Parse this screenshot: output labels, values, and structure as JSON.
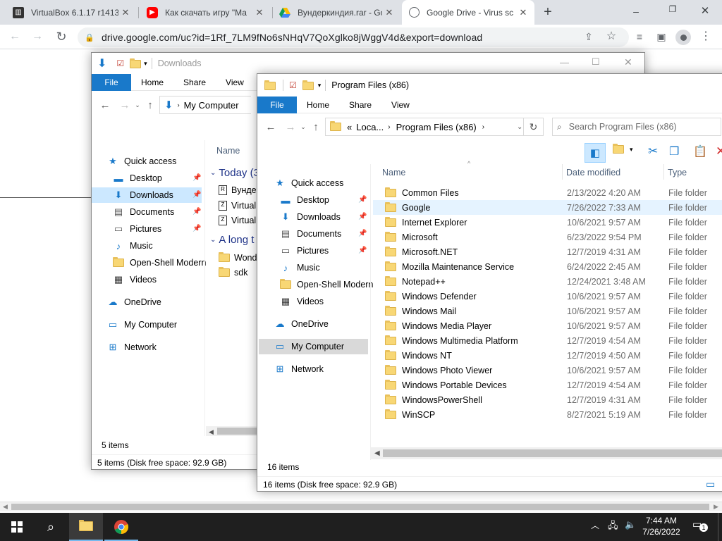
{
  "browser": {
    "tabs": [
      {
        "title": "VirtualBox 6.1.17 r1413",
        "icon": "virtualbox-icon"
      },
      {
        "title": "Как скачать игру \"Ма",
        "icon": "youtube-icon"
      },
      {
        "title": "Вундеркиндия.rar - Go",
        "icon": "google-drive-icon"
      },
      {
        "title": "Google Drive - Virus sc",
        "icon": "globe-icon"
      }
    ],
    "url": "drive.google.com/uc?id=1Rf_7LM9fNo6sNHqV7QoXglko8jWggV4d&export=download"
  },
  "downloads_window": {
    "title": "Downloads",
    "ribbon": [
      "File",
      "Home",
      "Share",
      "View"
    ],
    "address": "My Computer",
    "nav": [
      {
        "label": "Quick access",
        "icon": "star-icon"
      },
      {
        "label": "Desktop",
        "icon": "desktop-icon",
        "pinned": true
      },
      {
        "label": "Downloads",
        "icon": "download-arrow-icon",
        "pinned": true
      },
      {
        "label": "Documents",
        "icon": "documents-icon",
        "pinned": true
      },
      {
        "label": "Pictures",
        "icon": "pictures-icon",
        "pinned": true
      },
      {
        "label": "Music",
        "icon": "music-icon"
      },
      {
        "label": "Open-Shell Modern",
        "icon": "folder-icon"
      },
      {
        "label": "Videos",
        "icon": "videos-icon"
      },
      {
        "label": "OneDrive",
        "icon": "onedrive-icon"
      },
      {
        "label": "My Computer",
        "icon": "computer-icon"
      },
      {
        "label": "Network",
        "icon": "network-icon"
      }
    ],
    "column_name": "Name",
    "groups": [
      {
        "label": "Today (3",
        "items": [
          "Вундер",
          "Virtuall",
          "Virtual"
        ]
      },
      {
        "label": "A long t",
        "items": [
          "Wonde",
          "sdk"
        ]
      }
    ],
    "item_count": "5 items",
    "status": "5 items (Disk free space: 92.9 GB)"
  },
  "program_files_window": {
    "title": "Program Files (x86)",
    "ribbon": [
      "File",
      "Home",
      "Share",
      "View"
    ],
    "breadcrumb": [
      "«",
      "Loca...",
      "Program Files (x86)"
    ],
    "search_placeholder": "Search Program Files (x86)",
    "nav": [
      {
        "label": "Quick access",
        "icon": "star-icon"
      },
      {
        "label": "Desktop",
        "icon": "desktop-icon",
        "pinned": true
      },
      {
        "label": "Downloads",
        "icon": "download-arrow-icon",
        "pinned": true
      },
      {
        "label": "Documents",
        "icon": "documents-icon",
        "pinned": true
      },
      {
        "label": "Pictures",
        "icon": "pictures-icon",
        "pinned": true
      },
      {
        "label": "Music",
        "icon": "music-icon"
      },
      {
        "label": "Open-Shell Modern",
        "icon": "folder-icon"
      },
      {
        "label": "Videos",
        "icon": "videos-icon"
      },
      {
        "label": "OneDrive",
        "icon": "onedrive-icon"
      },
      {
        "label": "My Computer",
        "icon": "computer-icon"
      },
      {
        "label": "Network",
        "icon": "network-icon"
      }
    ],
    "columns": {
      "name": "Name",
      "date": "Date modified",
      "type": "Type"
    },
    "files": [
      {
        "name": "Common Files",
        "date": "2/13/2022 4:20 AM",
        "type": "File folder"
      },
      {
        "name": "Google",
        "date": "7/26/2022 7:33 AM",
        "type": "File folder"
      },
      {
        "name": "Internet Explorer",
        "date": "10/6/2021 9:57 AM",
        "type": "File folder"
      },
      {
        "name": "Microsoft",
        "date": "6/23/2022 9:54 PM",
        "type": "File folder"
      },
      {
        "name": "Microsoft.NET",
        "date": "12/7/2019 4:31 AM",
        "type": "File folder"
      },
      {
        "name": "Mozilla Maintenance Service",
        "date": "6/24/2022 2:45 AM",
        "type": "File folder"
      },
      {
        "name": "Notepad++",
        "date": "12/24/2021 3:48 AM",
        "type": "File folder"
      },
      {
        "name": "Windows Defender",
        "date": "10/6/2021 9:57 AM",
        "type": "File folder"
      },
      {
        "name": "Windows Mail",
        "date": "10/6/2021 9:57 AM",
        "type": "File folder"
      },
      {
        "name": "Windows Media Player",
        "date": "10/6/2021 9:57 AM",
        "type": "File folder"
      },
      {
        "name": "Windows Multimedia Platform",
        "date": "12/7/2019 4:54 AM",
        "type": "File folder"
      },
      {
        "name": "Windows NT",
        "date": "12/7/2019 4:50 AM",
        "type": "File folder"
      },
      {
        "name": "Windows Photo Viewer",
        "date": "10/6/2021 9:57 AM",
        "type": "File folder"
      },
      {
        "name": "Windows Portable Devices",
        "date": "12/7/2019 4:54 AM",
        "type": "File folder"
      },
      {
        "name": "WindowsPowerShell",
        "date": "12/7/2019 4:31 AM",
        "type": "File folder"
      },
      {
        "name": "WinSCP",
        "date": "8/27/2021 5:19 AM",
        "type": "File folder"
      }
    ],
    "item_count": "16 items",
    "status": "16 items (Disk free space: 92.9 GB)"
  },
  "taskbar": {
    "time": "7:44 AM",
    "date": "7/26/2022",
    "notification_count": "1"
  }
}
